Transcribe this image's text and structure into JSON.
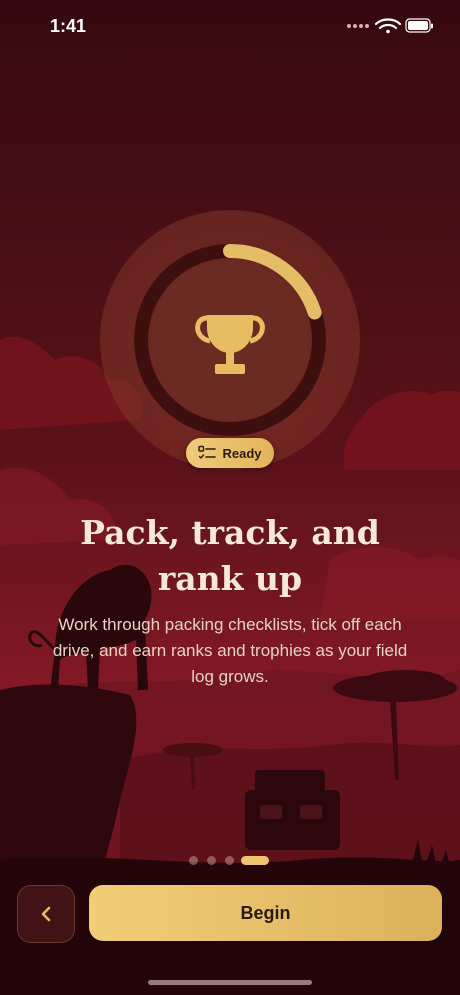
{
  "status": {
    "time": "1:41",
    "icons": [
      "cellular-dots-icon",
      "wifi-icon",
      "battery-icon"
    ]
  },
  "hero": {
    "icon": "trophy-icon",
    "progress": 0.2,
    "badge": {
      "icon": "checklist-icon",
      "label": "Ready"
    }
  },
  "content": {
    "headline_line1": "Pack, track, and",
    "headline_line2": "rank up",
    "body": "Work through packing checklists, tick off each drive, and earn ranks and trophies as your field log grows."
  },
  "pagination": {
    "total": 4,
    "current": 4
  },
  "actions": {
    "back_icon": "chevron-left-icon",
    "primary_label": "Begin"
  },
  "colors": {
    "background_top": "#3a0a10",
    "background_bottom": "#8c1a26",
    "accent_gold": "#eec46f",
    "text_light": "#f7e9da"
  }
}
